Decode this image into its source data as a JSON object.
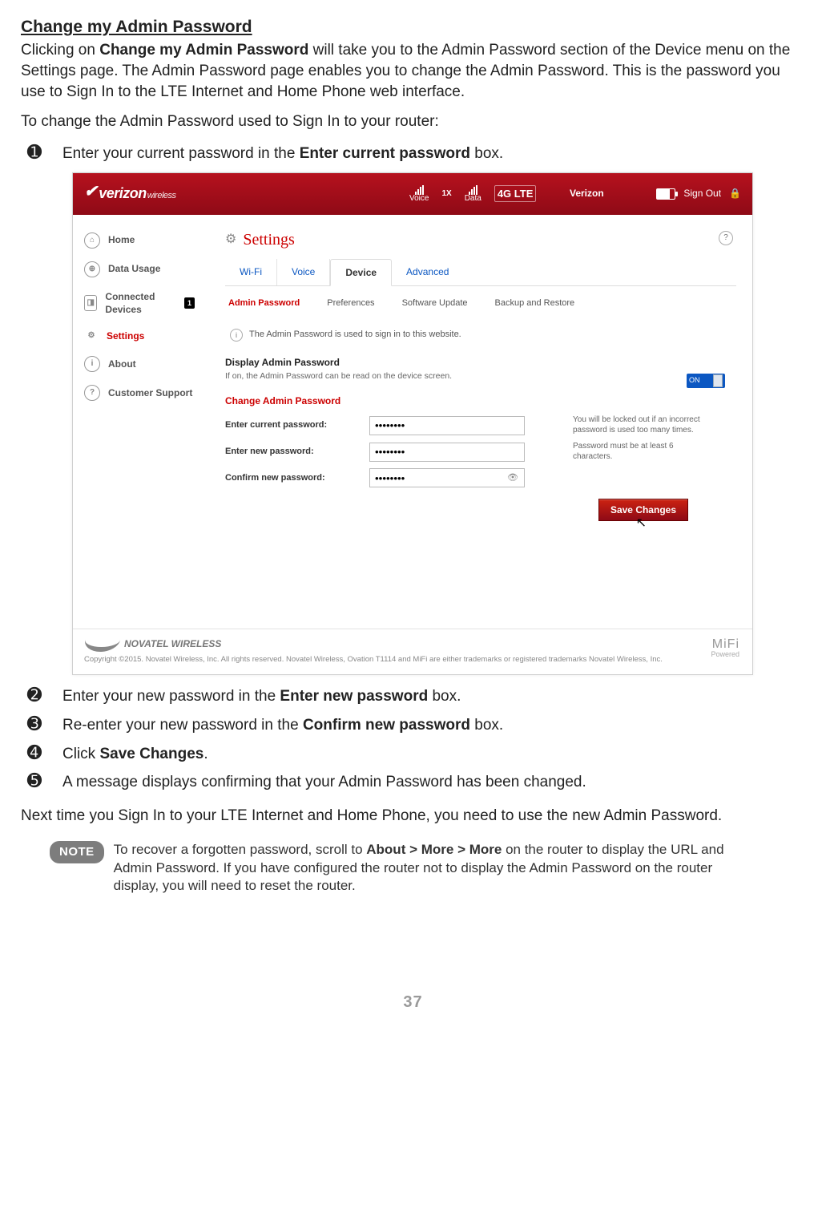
{
  "doc": {
    "heading": "Change my Admin Password",
    "intro_parts": {
      "p1a": "Clicking on ",
      "p1b": "Change my Admin Password",
      "p1c": " will take you to the Admin Password section of the Device menu on the Settings page. The Admin Password page enables you to change the Admin Password. This is the password you use to Sign In to the LTE Internet and Home Phone web interface."
    },
    "lead": "To change the Admin Password used to Sign In to your router:",
    "steps": {
      "s1": {
        "num": "➊",
        "a": "Enter your current password in the ",
        "b": "Enter current password",
        "c": " box."
      },
      "s2": {
        "num": "➋",
        "a": "Enter your new password in the ",
        "b": "Enter new password",
        "c": " box."
      },
      "s3": {
        "num": "➌",
        "a": "Re-enter your new password in the ",
        "b": "Confirm new password",
        "c": " box."
      },
      "s4": {
        "num": "➍",
        "a": "Click ",
        "b": "Save Changes",
        "c": "."
      },
      "s5": {
        "num": "➎",
        "a": " A message displays confirming that your Admin Password has been changed."
      }
    },
    "closing": "Next time you Sign In to your LTE Internet and Home Phone, you need to use the new Admin Password.",
    "note_label": "NOTE",
    "note_parts": {
      "a": "To recover a forgotten password, scroll to ",
      "b": "About > More > More",
      "c": " on the router to display the URL and Admin Password. If you have configured the router not to display the Admin Password on the router display, you will need to reset the router."
    },
    "page_number": "37"
  },
  "ui": {
    "brand_main": "verizon",
    "brand_sub": "wireless",
    "sig_voice_label": "Voice",
    "sig_voice_tech": "1X",
    "sig_data_label": "Data",
    "lte_badge": "4G LTE",
    "carrier": "Verizon",
    "sign_out": "Sign Out",
    "sidebar": {
      "home": "Home",
      "data_usage": "Data Usage",
      "connected": "Connected Devices",
      "connected_badge": "1",
      "settings": "Settings",
      "about": "About",
      "support": "Customer Support"
    },
    "page_title": "Settings",
    "tabs": {
      "wifi": "Wi-Fi",
      "voice": "Voice",
      "device": "Device",
      "advanced": "Advanced"
    },
    "subtabs": {
      "admin": "Admin Password",
      "prefs": "Preferences",
      "update": "Software Update",
      "backup": "Backup and Restore"
    },
    "info_text": "The Admin Password is used to sign in to this website.",
    "display_pw_title": "Display Admin Password",
    "display_pw_sub": "If on, the Admin Password can be read on the device screen.",
    "toggle_label": "ON",
    "change_pw_title": "Change Admin Password",
    "fields": {
      "current_label": "Enter current password:",
      "current_value": "••••••••",
      "current_hint": "You will be locked out if an incorrect password is used too many times.",
      "new_label": "Enter new password:",
      "new_value": "••••••••",
      "new_hint": "Password must be at least 6 characters.",
      "confirm_label": "Confirm new password:",
      "confirm_value": "••••••••"
    },
    "save_label": "Save Changes",
    "footer_company": "NOVATEL WIRELESS",
    "footer_copy": "Copyright ©2015. Novatel Wireless, Inc. All rights reserved. Novatel Wireless, Ovation T1114 and MiFi are either trademarks or registered trademarks Novatel Wireless, Inc.",
    "mifi_brand": "MiFi",
    "mifi_sub": "Powered"
  }
}
